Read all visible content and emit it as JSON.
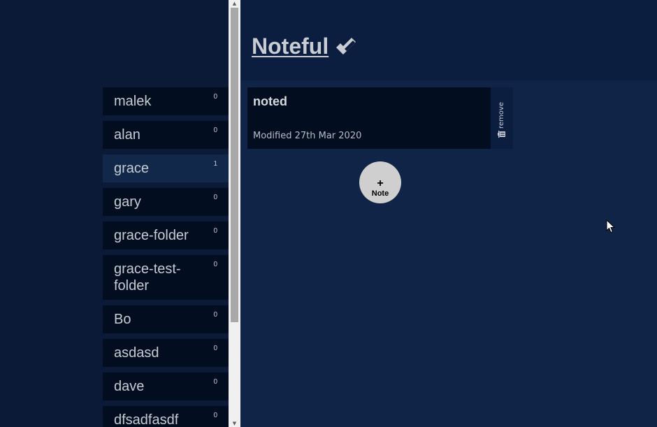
{
  "app": {
    "title": "Noteful"
  },
  "folders": [
    {
      "name": "malek",
      "count": "0",
      "active": false
    },
    {
      "name": "alan",
      "count": "0",
      "active": false
    },
    {
      "name": "grace",
      "count": "1",
      "active": true
    },
    {
      "name": "gary",
      "count": "0",
      "active": false
    },
    {
      "name": "grace-folder",
      "count": "0",
      "active": false
    },
    {
      "name": "grace-test-folder",
      "count": "0",
      "active": false
    },
    {
      "name": "Bo",
      "count": "0",
      "active": false
    },
    {
      "name": "asdasd",
      "count": "0",
      "active": false
    },
    {
      "name": "dave",
      "count": "0",
      "active": false
    },
    {
      "name": "dfsadfasdf",
      "count": "0",
      "active": false
    }
  ],
  "notes": [
    {
      "title": "noted",
      "modified": "Modified 27th Mar 2020",
      "remove_label": "remove"
    }
  ],
  "add_note": {
    "plus": "+",
    "label": "Note"
  },
  "icons": {
    "title_icon": "double-check-icon",
    "remove_icon": "trash-icon"
  },
  "colors": {
    "background": "#0b1a36",
    "header": "#0c1e40",
    "main": "#0f2446",
    "folder": "#020d20",
    "folder_active": "#11284a",
    "text": "#c7cbd3"
  }
}
